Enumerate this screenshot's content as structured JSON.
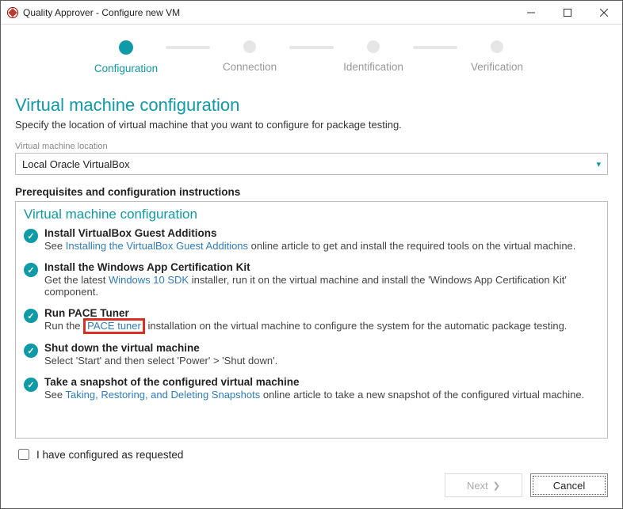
{
  "window": {
    "title": "Quality Approver - Configure new VM"
  },
  "stepper": {
    "steps": [
      {
        "label": "Configuration",
        "active": true
      },
      {
        "label": "Connection",
        "active": false
      },
      {
        "label": "Identification",
        "active": false
      },
      {
        "label": "Verification",
        "active": false
      }
    ]
  },
  "page": {
    "heading": "Virtual machine configuration",
    "subtitle": "Specify the location of virtual machine that you want to configure for package testing."
  },
  "vm_location": {
    "label": "Virtual machine location",
    "value": "Local Oracle VirtualBox"
  },
  "prereq_heading": "Prerequisites and configuration instructions",
  "instructions": {
    "subheading": "Virtual machine configuration",
    "items": [
      {
        "title": "Install VirtualBox Guest Additions",
        "pre": "See ",
        "link": "Installing the VirtualBox Guest Additions",
        "post": " online article to get and install the required tools on the virtual machine."
      },
      {
        "title": "Install the Windows App Certification Kit",
        "pre": "Get the latest ",
        "link": "Windows 10 SDK",
        "post": " installer, run it on the virtual machine and install the 'Windows App Certification Kit' component."
      },
      {
        "title": "Run PACE Tuner",
        "pre": "Run the ",
        "link": "PACE tuner",
        "post": " installation on the virtual machine to configure the system for the automatic package testing.",
        "highlight_link": true
      },
      {
        "title": "Shut down the virtual machine",
        "pre": "Select 'Start' and then select 'Power' > 'Shut down'.",
        "link": "",
        "post": ""
      },
      {
        "title": "Take a snapshot of the configured virtual machine",
        "pre": "See ",
        "link": "Taking, Restoring, and Deleting Snapshots",
        "post": " online article to take a new snapshot of the configured virtual machine."
      }
    ]
  },
  "confirm": {
    "label": "I have configured as requested",
    "checked": false
  },
  "buttons": {
    "next": "Next",
    "cancel": "Cancel"
  }
}
